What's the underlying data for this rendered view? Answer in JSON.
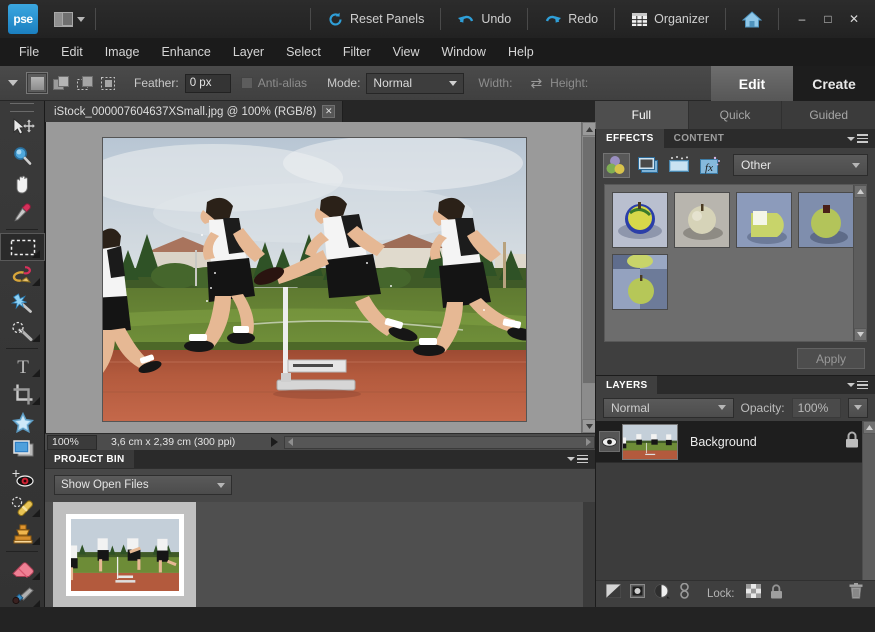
{
  "app": {
    "logo_text": "pse",
    "title_actions": [
      {
        "name": "reset-panels",
        "label": "Reset Panels",
        "icon": "reset-icon"
      },
      {
        "name": "undo",
        "label": "Undo",
        "icon": "undo-arrow-icon"
      },
      {
        "name": "redo",
        "label": "Redo",
        "icon": "redo-arrow-icon"
      },
      {
        "name": "organizer",
        "label": "Organizer",
        "icon": "grid-icon"
      }
    ],
    "home_icon": "home-icon",
    "window_buttons": {
      "minimize": "–",
      "maximize": "□",
      "close": "✕"
    }
  },
  "menubar": {
    "items": [
      "File",
      "Edit",
      "Image",
      "Enhance",
      "Layer",
      "Select",
      "Filter",
      "View",
      "Window",
      "Help"
    ]
  },
  "options_bar": {
    "feather_label": "Feather:",
    "feather_value": "0 px",
    "antialias_label": "Anti-alias",
    "antialias_checked": false,
    "mode_label": "Mode:",
    "mode_value": "Normal",
    "width_label": "Width:",
    "width_value": "",
    "height_label": "Height:",
    "height_value": "",
    "selection_modes": [
      "new-selection",
      "add-to-selection",
      "subtract-from-selection",
      "intersect-selection"
    ],
    "selection_mode_active": 0
  },
  "mode_tabs": {
    "primary": [
      {
        "label": "Edit",
        "active": true
      },
      {
        "label": "Create",
        "active": false
      }
    ],
    "secondary": [
      {
        "label": "Full",
        "active": true
      },
      {
        "label": "Quick",
        "active": false
      },
      {
        "label": "Guided",
        "active": false
      }
    ]
  },
  "toolbox": {
    "tools": [
      {
        "name": "move-tool",
        "label": "Move",
        "selected": false,
        "submenu": false
      },
      {
        "name": "zoom-tool",
        "label": "Zoom",
        "selected": false,
        "submenu": false
      },
      {
        "name": "hand-tool",
        "label": "Hand",
        "selected": false,
        "submenu": false
      },
      {
        "name": "eyedropper-tool",
        "label": "Eyedropper",
        "selected": false,
        "submenu": false
      },
      {
        "name": "rectangular-marquee-tool",
        "label": "Rectangular Marquee",
        "selected": true,
        "submenu": true
      },
      {
        "name": "lasso-tool",
        "label": "Lasso",
        "selected": false,
        "submenu": true
      },
      {
        "name": "magic-wand-tool",
        "label": "Magic Wand",
        "selected": false,
        "submenu": false
      },
      {
        "name": "quick-selection-tool",
        "label": "Quick Selection",
        "selected": false,
        "submenu": true
      },
      {
        "name": "type-tool",
        "label": "Type",
        "selected": false,
        "submenu": true
      },
      {
        "name": "crop-tool",
        "label": "Crop",
        "selected": false,
        "submenu": true
      },
      {
        "name": "cookie-cutter-tool",
        "label": "Cookie Cutter",
        "selected": false,
        "submenu": false
      },
      {
        "name": "straighten-tool",
        "label": "Straighten",
        "selected": false,
        "submenu": false
      },
      {
        "name": "red-eye-removal-tool",
        "label": "Red Eye Removal",
        "selected": false,
        "submenu": false
      },
      {
        "name": "healing-brush-tool",
        "label": "Healing Brush",
        "selected": false,
        "submenu": true
      },
      {
        "name": "clone-stamp-tool",
        "label": "Clone Stamp",
        "selected": false,
        "submenu": true
      },
      {
        "name": "eraser-tool",
        "label": "Eraser",
        "selected": false,
        "submenu": true
      },
      {
        "name": "brush-tool",
        "label": "Brush",
        "selected": false,
        "submenu": true
      }
    ]
  },
  "document": {
    "tab_title": "iStock_000007604637XSmall.jpg @ 100% (RGB/8)",
    "close_glyph": "✕",
    "image_alt": "four male athletes sprinting over a hurdle on a red running track"
  },
  "status_bar": {
    "zoom": "100%",
    "dimensions": "3,6 cm x 2,39 cm (300 ppi)"
  },
  "project_bin": {
    "tab_label": "PROJECT BIN",
    "filter_value": "Show Open Files",
    "thumbnail_alt": "hurdle race photo thumbnail"
  },
  "effects_panel": {
    "tabs": [
      {
        "label": "EFFECTS",
        "active": true
      },
      {
        "label": "CONTENT",
        "active": false
      }
    ],
    "category_buttons": [
      {
        "name": "filters-button",
        "active": true
      },
      {
        "name": "layer-styles-button",
        "active": false
      },
      {
        "name": "photo-effects-button",
        "active": false
      },
      {
        "name": "fx-effects-button",
        "active": false
      }
    ],
    "category_value": "Other",
    "thumbnail_count": 5,
    "thumbnails_alt": "green apple effect previews",
    "apply_label": "Apply"
  },
  "layers_panel": {
    "tab_label": "LAYERS",
    "blend_mode": "Normal",
    "opacity_label": "Opacity:",
    "opacity_value": "100%",
    "layers": [
      {
        "name": "Background",
        "visible": true,
        "locked": true
      }
    ],
    "footer": {
      "buttons": [
        "new-layer-button",
        "add-layer-mask-button",
        "adjustment-layer-button",
        "link-layers-button"
      ],
      "lock_label": "Lock:",
      "lock_transparency": "lock-transparent-pixels",
      "lock_all": "lock-all",
      "delete": "delete-layer-button"
    }
  },
  "colors": {
    "accent_blue": "#2f9fd8",
    "panel_bg": "#3f3f3f",
    "chrome_dark": "#232323",
    "menubar_bg": "#1b1b1b",
    "canvas_bg": "#9a9a9a",
    "text_light": "#dedede"
  }
}
